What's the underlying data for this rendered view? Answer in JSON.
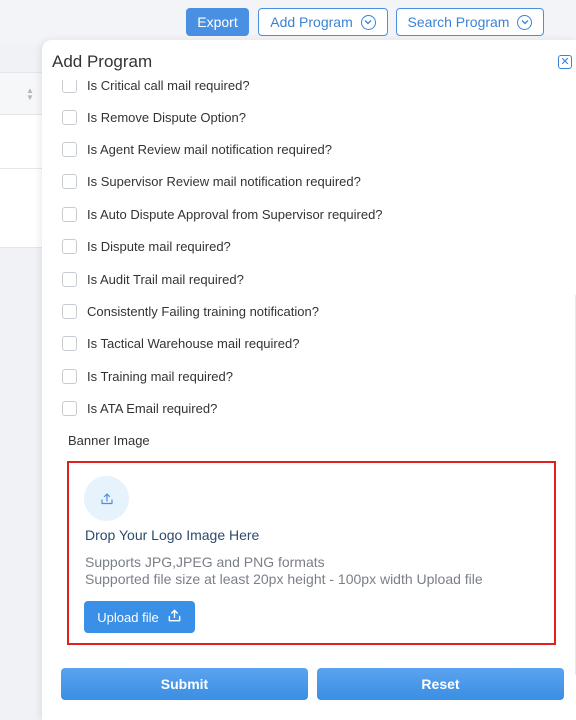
{
  "toolbar": {
    "export_label": "Export",
    "add_program_label": "Add Program",
    "search_program_label": "Search Program"
  },
  "modal": {
    "title": "Add Program",
    "checkboxes": [
      {
        "label": "Is Critical call mail required?",
        "checked": false
      },
      {
        "label": "Is Remove Dispute Option?",
        "checked": false
      },
      {
        "label": "Is Agent Review mail notification required?",
        "checked": false
      },
      {
        "label": "Is Supervisor Review mail notification required?",
        "checked": false
      },
      {
        "label": "Is Auto Dispute Approval from Supervisor required?",
        "checked": false
      },
      {
        "label": "Is Dispute mail required?",
        "checked": false
      },
      {
        "label": "Is Audit Trail mail required?",
        "checked": false
      },
      {
        "label": "Consistently Failing training notification?",
        "checked": false
      },
      {
        "label": "Is Tactical Warehouse mail required?",
        "checked": false
      },
      {
        "label": "Is Training mail required?",
        "checked": false
      },
      {
        "label": "Is ATA Email required?",
        "checked": false
      }
    ],
    "banner": {
      "label": "Banner Image",
      "drop_title": "Drop Your Logo Image Here",
      "formats": "Supports JPG,JPEG and PNG formats",
      "size_note": "Supported file size at least 20px height - 100px width Upload file",
      "upload_label": "Upload file"
    },
    "submit_label": "Submit",
    "reset_label": "Reset"
  },
  "colors": {
    "accent": "#4a90e2",
    "highlight_border": "#e02020"
  }
}
